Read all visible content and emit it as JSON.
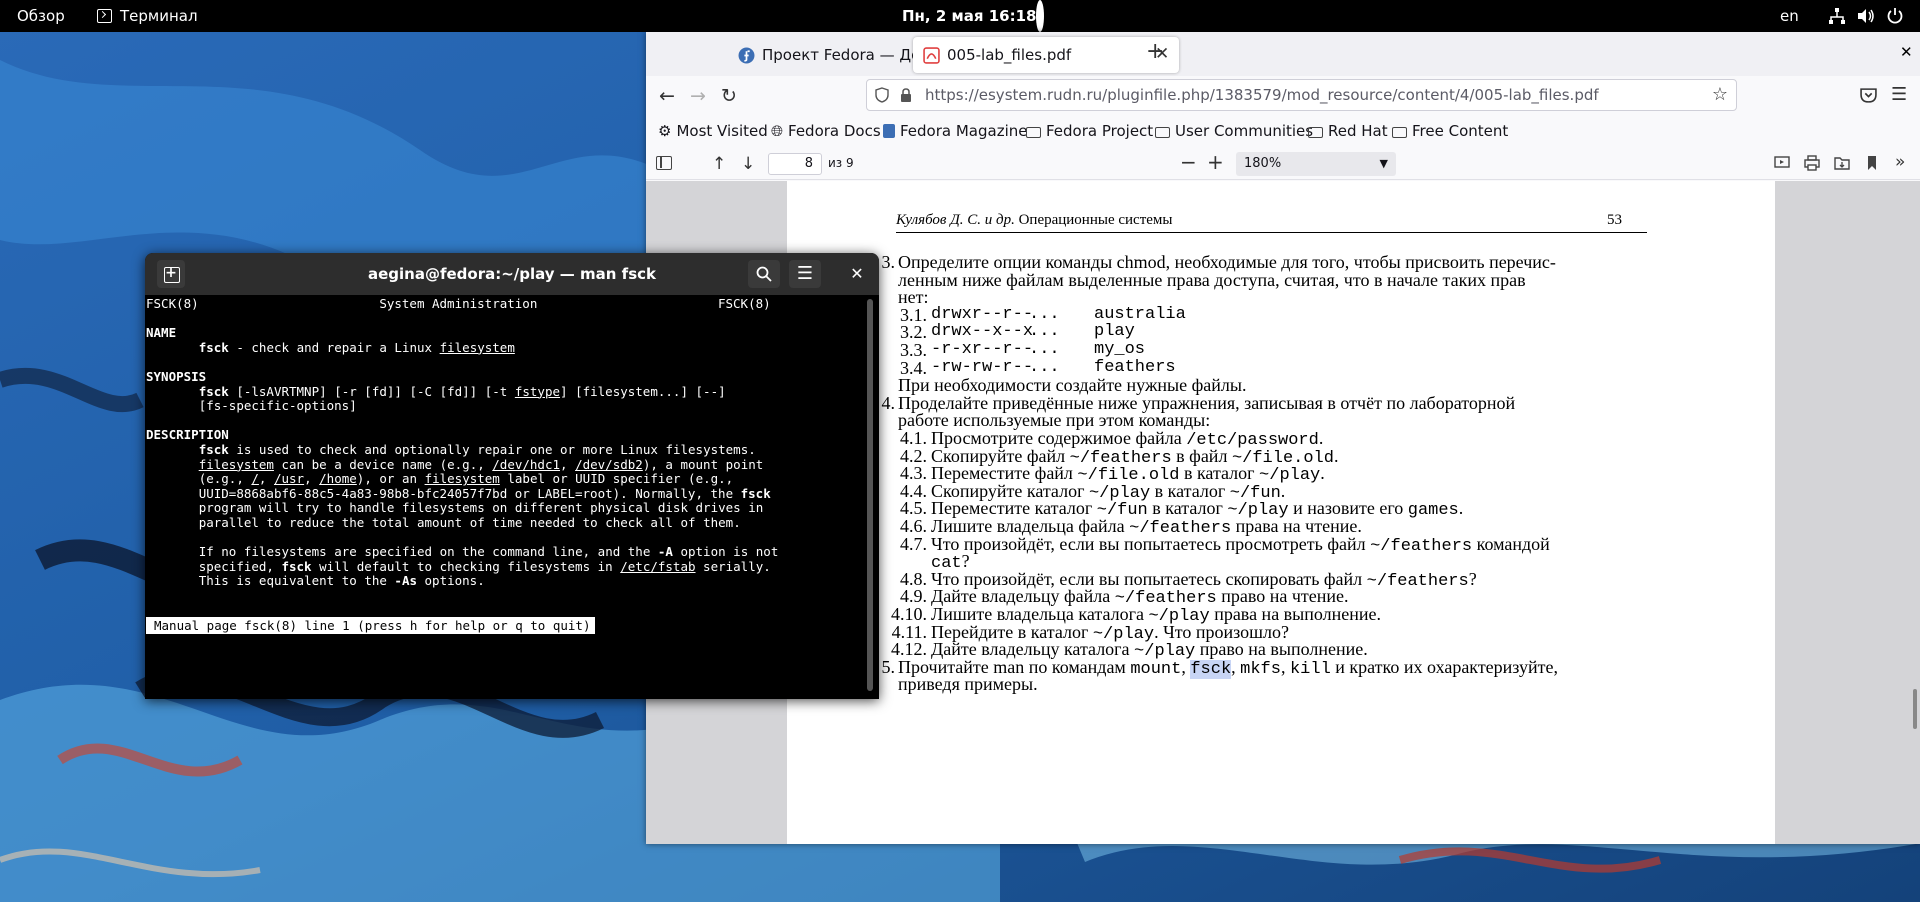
{
  "topbar": {
    "overview": "Обзор",
    "app_name": "Терминал",
    "clock": "Пн, 2 мая  16:18",
    "lang": "en"
  },
  "firefox": {
    "tabs": [
      {
        "title": "Проект Fedora — Домашняя страница"
      },
      {
        "title": "005-lab_files.pdf"
      }
    ],
    "url": "https://esystem.rudn.ru/pluginfile.php/1383579/mod_resource/content/4/005-lab_files.pdf",
    "bookmarks": [
      "Most Visited",
      "Fedora Docs",
      "Fedora Magazine",
      "Fedora Project",
      "User Communities",
      "Red Hat",
      "Free Content"
    ],
    "pdf": {
      "page_number": "8",
      "page_of": "из 9",
      "zoom": "180%",
      "header_author": "Кулябов Д. С. и др.",
      "header_title": "Операционные системы",
      "page_no": "53",
      "lines": [
        {
          "num": "3.",
          "text": "Определите опции команды chmod, необходимые для того, чтобы присвоить перечис-"
        },
        {
          "num": "",
          "text": "ленным ниже файлам выделенные права доступа, считая, что в начале таких прав"
        },
        {
          "num": "",
          "text": "нет:"
        },
        {
          "num": "3.1.",
          "perm": "drwxr--r--",
          "dots": "...",
          "file": "australia"
        },
        {
          "num": "3.2.",
          "perm": "drwx--x--x",
          "dots": "...",
          "file": "play"
        },
        {
          "num": "3.3.",
          "perm": "-r-xr--r--",
          "dots": "...",
          "file": "my_os"
        },
        {
          "num": "3.4.",
          "perm": "-rw-rw-r--",
          "dots": "...",
          "file": "feathers"
        },
        {
          "num": "",
          "text": "При необходимости создайте нужные файлы."
        },
        {
          "num": "4.",
          "text": "Проделайте приведённые ниже упражнения, записывая в отчёт по лабораторной"
        },
        {
          "num": "",
          "text": "работе используемые при этом команды:"
        },
        {
          "num": "4.1.",
          "text": "Просмотрите содержимое файла /etc/password."
        },
        {
          "num": "4.2.",
          "text": "Скопируйте файл ~/feathers в файл ~/file.old."
        },
        {
          "num": "4.3.",
          "text": "Переместите файл ~/file.old в каталог ~/play."
        },
        {
          "num": "4.4.",
          "text": "Скопируйте каталог ~/play в каталог ~/fun."
        },
        {
          "num": "4.5.",
          "text": "Переместите каталог ~/fun в каталог ~/play и назовите его games."
        },
        {
          "num": "4.6.",
          "text": "Лишите владельца файла ~/feathers права на чтение."
        },
        {
          "num": "4.7.",
          "text": "Что произойдёт, если вы попытаетесь просмотреть файл ~/feathers командой"
        },
        {
          "num": "",
          "text": "cat?"
        },
        {
          "num": "4.8.",
          "text": "Что произойдёт, если вы попытаетесь скопировать файл ~/feathers?"
        },
        {
          "num": "4.9.",
          "text": "Дайте владельцу файла ~/feathers право на чтение."
        },
        {
          "num": "4.10.",
          "text": "Лишите владельца каталога ~/play права на выполнение."
        },
        {
          "num": "4.11.",
          "text": "Перейдите в каталог ~/play. Что произошло?"
        },
        {
          "num": "4.12.",
          "text": "Дайте владельцу каталога ~/play право на выполнение."
        },
        {
          "num": "5.",
          "text": "Прочитайте man по командам mount, fsck, mkfs, kill и кратко их охарактеризуйте,"
        },
        {
          "num": "",
          "text": "приведя примеры."
        }
      ]
    }
  },
  "terminal": {
    "title": "aegina@fedora:~/play — man fsck",
    "lines": [
      "FSCK(8)                        System Administration                        FSCK(8)",
      "",
      "NAME",
      "       fsck - check and repair a Linux filesystem",
      "",
      "SYNOPSIS",
      "       fsck [-lsAVRTMNP] [-r [fd]] [-C [fd]] [-t fstype] [filesystem...] [--]",
      "       [fs-specific-options]",
      "",
      "DESCRIPTION",
      "       fsck is used to check and optionally repair one or more Linux filesystems.",
      "       filesystem can be a device name (e.g., /dev/hdc1, /dev/sdb2), a mount point",
      "       (e.g., /, /usr, /home), or an filesystem label or UUID specifier (e.g.,",
      "       UUID=8868abf6-88c5-4a83-98b8-bfc24057f7bd or LABEL=root). Normally, the fsck",
      "       program will try to handle filesystems on different physical disk drives in",
      "       parallel to reduce the total amount of time needed to check all of them.",
      "",
      "       If no filesystems are specified on the command line, and the -A option is not",
      "       specified, fsck will default to checking filesystems in /etc/fstab serially.",
      "       This is equivalent to the -As options."
    ],
    "status": "Manual page fsck(8) line 1 (press h for help or q to quit)"
  }
}
